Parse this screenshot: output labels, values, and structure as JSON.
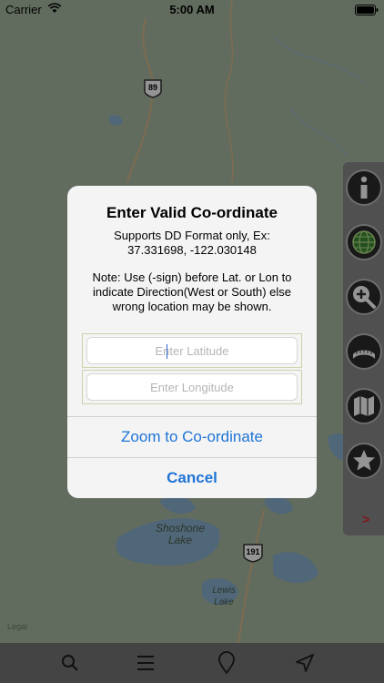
{
  "status_bar": {
    "carrier": "Carrier",
    "time": "5:00 AM"
  },
  "map": {
    "road_shields": [
      "89",
      "191"
    ],
    "labels": {
      "shoshone": "Shoshone\nLake",
      "lewis": "Lewis\nLake",
      "legal": "Legal"
    }
  },
  "dialog": {
    "title": "Enter Valid Co-ordinate",
    "message_format": "Supports DD Format only, Ex:\n37.331698, -122.030148",
    "message_note": "Note: Use (-sign) before Lat. or Lon to indicate Direction(West or South) else wrong location may be shown.",
    "latitude_placeholder": "Enter Latitude",
    "longitude_placeholder": "Enter Longitude",
    "zoom_button": "Zoom to Co-ordinate",
    "cancel_button": "Cancel"
  },
  "side_toolbar": {
    "icons": [
      "info-icon",
      "globe-icon",
      "zoom-in-icon",
      "ruler-icon",
      "map-icon",
      "star-icon"
    ],
    "chevron": ">"
  },
  "bottom_bar": {
    "icons": [
      "search-icon",
      "menu-icon",
      "location-pin-icon",
      "navigation-arrow-icon"
    ]
  },
  "colors": {
    "accent": "#1e74d6",
    "chevron": "#e0222a"
  }
}
